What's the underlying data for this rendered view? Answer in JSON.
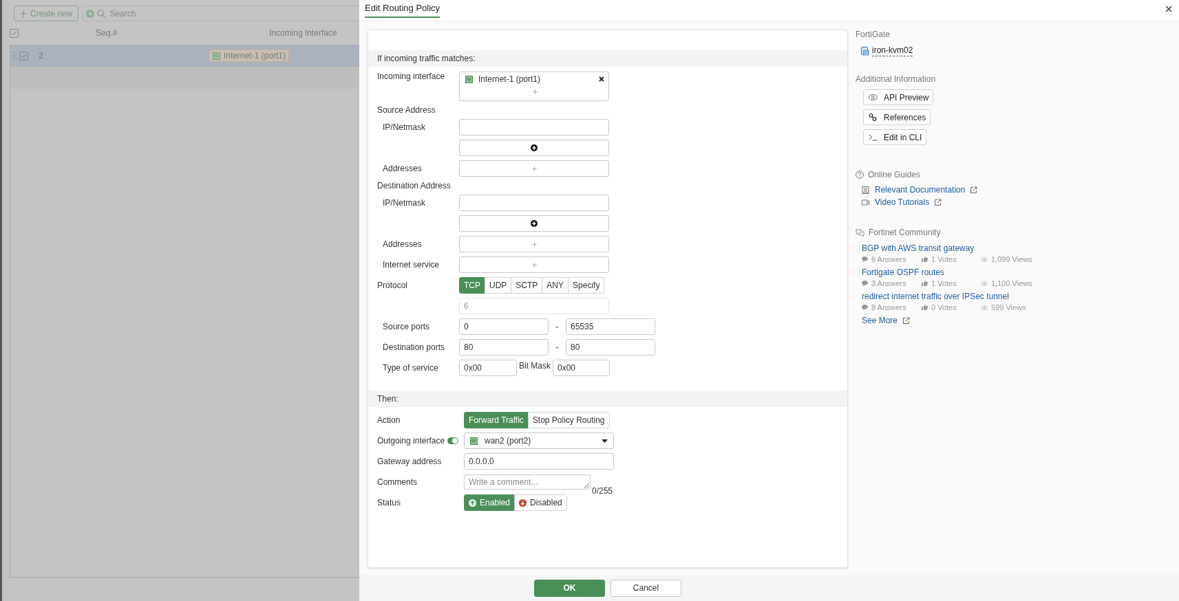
{
  "list_view": {
    "create_button": "Create new",
    "search": {
      "placeholder": "Search"
    },
    "select_all": {
      "checked": true
    },
    "columns": [
      "Seq.#",
      "Incoming Interface"
    ],
    "rows": [
      {
        "selected": true,
        "checked": true,
        "seq": "2",
        "incoming_interface": "Internet-1 (port1)"
      }
    ]
  },
  "dialog": {
    "title": "Edit Routing Policy",
    "match": {
      "title": "If incoming traffic matches:",
      "rows": [
        {
          "kind": "chips",
          "label": "Incoming interface",
          "chip": "Internet-1 (port1)"
        },
        {
          "kind": "group",
          "label": "Source Address",
          "children": [
            {
              "kind": "input",
              "label": "IP/Netmask"
            },
            {
              "kind": "add_row"
            },
            {
              "kind": "picker",
              "label": "Addresses"
            }
          ]
        },
        {
          "kind": "group",
          "label": "Destination Address",
          "children": [
            {
              "kind": "input",
              "label": "IP/Netmask"
            },
            {
              "kind": "add_row"
            },
            {
              "kind": "picker",
              "label": "Addresses"
            },
            {
              "kind": "picker",
              "label": "Internet service"
            }
          ]
        },
        {
          "kind": "segmented",
          "label": "Protocol",
          "options": [
            {
              "label": "TCP",
              "selected": true
            },
            {
              "label": "UDP",
              "selected": false
            },
            {
              "label": "SCTP",
              "selected": false
            },
            {
              "label": "ANY",
              "selected": false
            },
            {
              "label": "Specify",
              "selected": false
            }
          ]
        },
        {
          "kind": "number",
          "value": "6",
          "disabled": true
        },
        {
          "kind": "group",
          "children": [
            {
              "kind": "range",
              "label": "Source ports",
              "from": "0",
              "separator": "-",
              "to": "65535"
            },
            {
              "kind": "range",
              "label": "Destination ports",
              "from": "80",
              "separator": "-",
              "to": "80"
            },
            {
              "kind": "tos",
              "label": "Type of service",
              "value": "0x00",
              "mask_label": "Bit Mask",
              "mask": "0x00"
            }
          ]
        }
      ]
    },
    "then": {
      "title": "Then:",
      "rows": [
        {
          "kind": "segmented",
          "label": "Action",
          "options": [
            {
              "label": "Forward Traffic",
              "selected": true
            },
            {
              "label": "Stop Policy Routing",
              "selected": false
            }
          ]
        },
        {
          "kind": "select",
          "label": "Outgoing interface",
          "toggle_on": true,
          "value": "wan2 (port2)"
        },
        {
          "kind": "input",
          "label": "Gateway address",
          "value": "0.0.0.0"
        },
        {
          "kind": "textarea",
          "label": "Comments",
          "placeholder": "Write a comment...",
          "counter": "0/255"
        },
        {
          "kind": "status",
          "label": "Status",
          "options": [
            {
              "label": "Enabled",
              "selected": true,
              "kind": "up"
            },
            {
              "label": "Disabled",
              "selected": false,
              "kind": "down"
            }
          ]
        }
      ]
    },
    "buttons": [
      {
        "label": "OK",
        "primary": true
      },
      {
        "label": "Cancel",
        "primary": false
      }
    ],
    "sidebar": {
      "device_heading": "FortiGate",
      "device": "iron-kvm02",
      "info_heading": "Additional Information",
      "info_buttons": [
        {
          "kind": "api",
          "label": "API Preview"
        },
        {
          "kind": "references",
          "label": "References"
        },
        {
          "kind": "cli",
          "label": "Edit in CLI"
        }
      ],
      "guides_heading": "Online Guides",
      "guides": [
        {
          "kind": "doc",
          "label": "Relevant Documentation"
        },
        {
          "kind": "video",
          "label": "Video Tutorials"
        }
      ],
      "community_heading": "Fortinet Community",
      "posts": [
        {
          "title": "BGP with AWS transit gateway",
          "answers": "6 Answers",
          "votes": "1 Votes",
          "views": "1,099 Views"
        },
        {
          "title": "Fortigate OSPF routes",
          "answers": "3 Answers",
          "votes": "1 Votes",
          "views": "1,100 Views"
        },
        {
          "title": "redirect internet traffic over IPSec tunnel",
          "answers": "8 Answers",
          "votes": "0 Votes",
          "views": "599 Views"
        }
      ],
      "see_more": "See More"
    }
  }
}
